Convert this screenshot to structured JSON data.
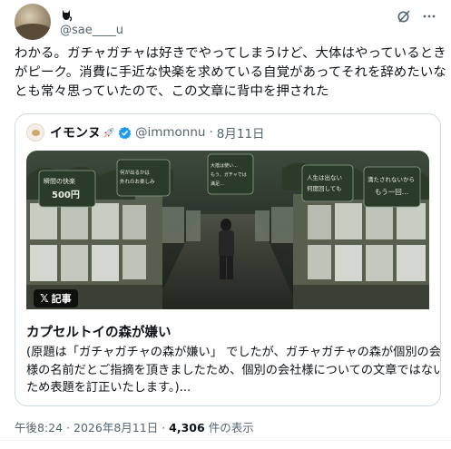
{
  "author": {
    "display_name": "",
    "handle": "@sae____u",
    "badge_icon": "cat-icon"
  },
  "tweet": {
    "text_lines": [
      "わかる。ガチャガチャは好きでやってしまうけど、大体はやっているとき",
      "がピーク。消費に手近な快楽を求めている自覚があってそれを辞めたいな",
      "とも常々思っていたので、この文章に背中を押された"
    ]
  },
  "quote": {
    "display_name": "イモンヌ",
    "name_emoji_icon": "rocket-icon",
    "verified_icon": "verified-badge-icon",
    "handle": "@immonnu",
    "separator": "·",
    "date": "8月11日",
    "badge_label": "記事",
    "badge_icon": "x-logo-icon",
    "image_signs": [
      "瞬間の快楽 500円",
      "何が出るかは 外れのお楽しみ",
      "大抵は使い… もう、ガチャでは 満足…",
      "人生は出ない 何度回しても",
      "満たされないから もう一回…"
    ],
    "article_title": "カプセルトイの森が嫌い",
    "article_lines": [
      "(原題は「ガチャガチャの森が嫌い」 でしたが、ガチャガチャの森が個別の会社",
      "様の名前だとご指摘を頂きましたため、個別の会社様についての文章ではない",
      "ため表題を訂正いたします。)..."
    ]
  },
  "meta": {
    "time": "午後8:24",
    "sep1": "·",
    "date": "2026年8月11日",
    "sep2": "·",
    "views": "4,306",
    "views_suffix": "件の表示"
  },
  "icons": {
    "grok": "grok-icon",
    "more": "more-icon"
  },
  "colors": {
    "text": "#0f1419",
    "secondary": "#536471",
    "border": "#cfd9de",
    "verified": "#1d9bf0"
  }
}
